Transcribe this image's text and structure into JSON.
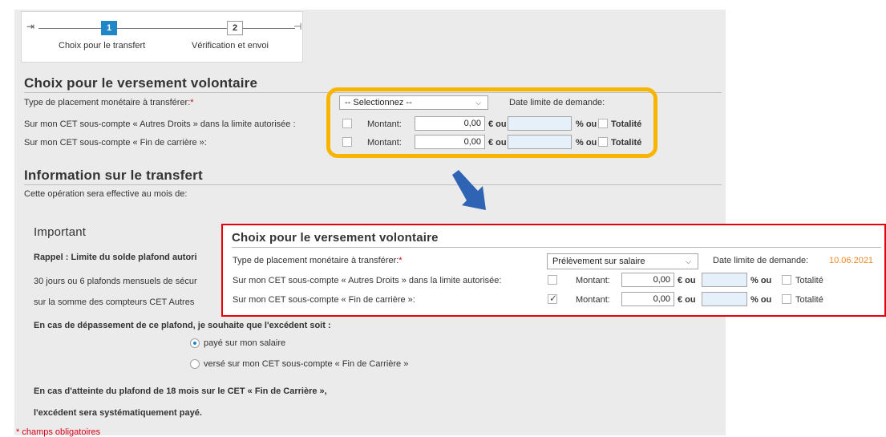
{
  "stepper": {
    "steps": [
      {
        "number": "1",
        "label": "Choix pour le transfert"
      },
      {
        "number": "2",
        "label": "Vérification et envoi"
      }
    ]
  },
  "versement": {
    "title": "Choix pour le versement volontaire",
    "type_label": "Type de placement monétaire à transférer:",
    "required_mark": "*",
    "select_value": "-- Selectionnez --",
    "date_label": "Date limite de demande:",
    "rows": [
      {
        "label": "Sur mon CET sous-compte « Autres Droits » dans la limite autorisée :",
        "montant_label": "Montant:",
        "amount": "0,00",
        "euro_ou": "€ ou",
        "pct_ou": "% ou",
        "totalite": "Totalité"
      },
      {
        "label": "Sur mon CET sous-compte « Fin de carrière »:",
        "montant_label": "Montant:",
        "amount": "0,00",
        "euro_ou": "€ ou",
        "pct_ou": "% ou",
        "totalite": "Totalité"
      }
    ]
  },
  "transfert": {
    "title": "Information sur le transfert",
    "effective_text": "Cette opération sera effective au mois de:"
  },
  "important": {
    "title": "Important",
    "line1": "Rappel : Limite du solde plafond autori",
    "line2": "30 jours ou 6 plafonds mensuels de sécur",
    "line3": "sur la somme des compteurs CET Autres",
    "depassement": "En cas de dépassement de ce plafond, je souhaite que l'excédent soit :",
    "radio_options": [
      "payé sur mon salaire",
      "versé sur mon CET sous-compte « Fin de Carrière »"
    ],
    "atteinte": "En cas d'atteinte du plafond de 18 mois sur le CET « Fin de Carrière »,",
    "excedent": "l'excédent sera systématiquement payé.",
    "required_note": "* champs obligatoires"
  },
  "popup": {
    "title": "Choix pour le versement volontaire",
    "type_label": "Type de placement monétaire à transférer:",
    "required_mark": "*",
    "select_value": "Prélèvement sur salaire",
    "date_label": "Date limite de demande:",
    "date_value": "10.06.2021",
    "rows": [
      {
        "label": "Sur mon CET sous-compte « Autres Droits » dans la limite autorisée:",
        "montant_label": "Montant:",
        "amount": "0,00",
        "euro_ou": "€ ou",
        "pct_ou": "% ou",
        "totalite": "Totalité",
        "checked": false
      },
      {
        "label": "Sur mon CET sous-compte « Fin de carrière »:",
        "montant_label": "Montant:",
        "amount": "0,00",
        "euro_ou": "€ ou",
        "pct_ou": "% ou",
        "totalite": "Totalité",
        "checked": true
      }
    ]
  },
  "colors": {
    "step_active": "#1f86c8",
    "highlight_orange": "#f7b500",
    "highlight_red": "#e8000b",
    "arrow_blue": "#2f63b3",
    "date_orange": "#f08a24",
    "required_red": "#d9001b"
  },
  "icons": [
    "step-start-icon",
    "step-end-icon",
    "chevron-down-icon",
    "annotation-arrow-icon",
    "checkmark-icon",
    "radio-icon"
  ]
}
